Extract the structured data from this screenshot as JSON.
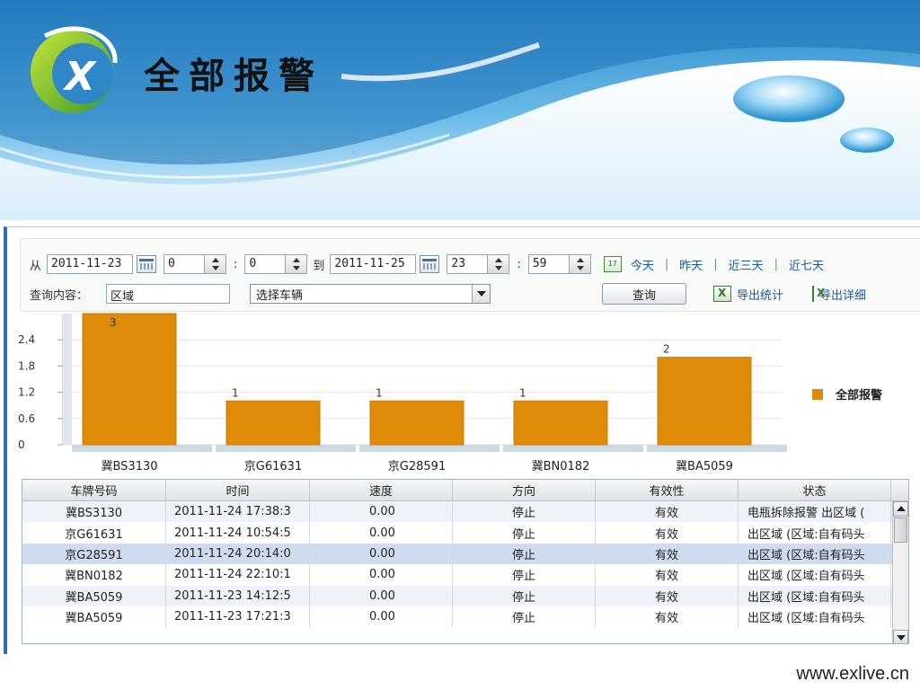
{
  "header": {
    "title": "全部报警",
    "logo": "exlive-logo"
  },
  "query": {
    "from_label": "从",
    "from_date": "2011-11-23",
    "from_hour": "0",
    "from_minute": "0",
    "to_label": "到",
    "to_date": "2011-11-25",
    "to_hour": "23",
    "to_minute": "59",
    "quick_links": [
      "今天",
      "昨天",
      "近三天",
      "近七天"
    ],
    "content_label": "查询内容：",
    "content_value": "区域",
    "vehicle_select": "选择车辆",
    "search_button": "查询",
    "export_stats": "导出统计",
    "export_detail": "导出详细"
  },
  "chart_data": {
    "type": "bar",
    "categories": [
      "冀BS3130",
      "京G61631",
      "京G28591",
      "冀BN0182",
      "冀BA5059"
    ],
    "series": [
      {
        "name": "全部报警",
        "values": [
          3,
          1,
          1,
          1,
          2
        ]
      }
    ],
    "y_ticks": [
      "0",
      "0.6",
      "1.2",
      "1.8",
      "2.4"
    ],
    "ylim": [
      0,
      3
    ],
    "legend_position": "right",
    "bar_color": "#e08a0b"
  },
  "table": {
    "columns": [
      "车牌号码",
      "时间",
      "速度",
      "方向",
      "有效性",
      "状态"
    ],
    "rows": [
      [
        "冀BS3130",
        "2011-11-24 17:38:3",
        "0.00",
        "停止",
        "有效",
        "电瓶拆除报警 出区域 ("
      ],
      [
        "京G61631",
        "2011-11-24 10:54:5",
        "0.00",
        "停止",
        "有效",
        "出区域 (区域:自有码头"
      ],
      [
        "京G28591",
        "2011-11-24 20:14:0",
        "0.00",
        "停止",
        "有效",
        "出区域 (区域:自有码头"
      ],
      [
        "冀BN0182",
        "2011-11-24 22:10:1",
        "0.00",
        "停止",
        "有效",
        "出区域 (区域:自有码头"
      ],
      [
        "冀BA5059",
        "2011-11-23 14:12:5",
        "0.00",
        "停止",
        "有效",
        "出区域 (区域:自有码头"
      ],
      [
        "冀BA5059",
        "2011-11-23 17:21:3",
        "0.00",
        "停止",
        "有效",
        "出区域 (区域:自有码头"
      ]
    ]
  },
  "footer": {
    "site": "www.exlive.cn"
  }
}
